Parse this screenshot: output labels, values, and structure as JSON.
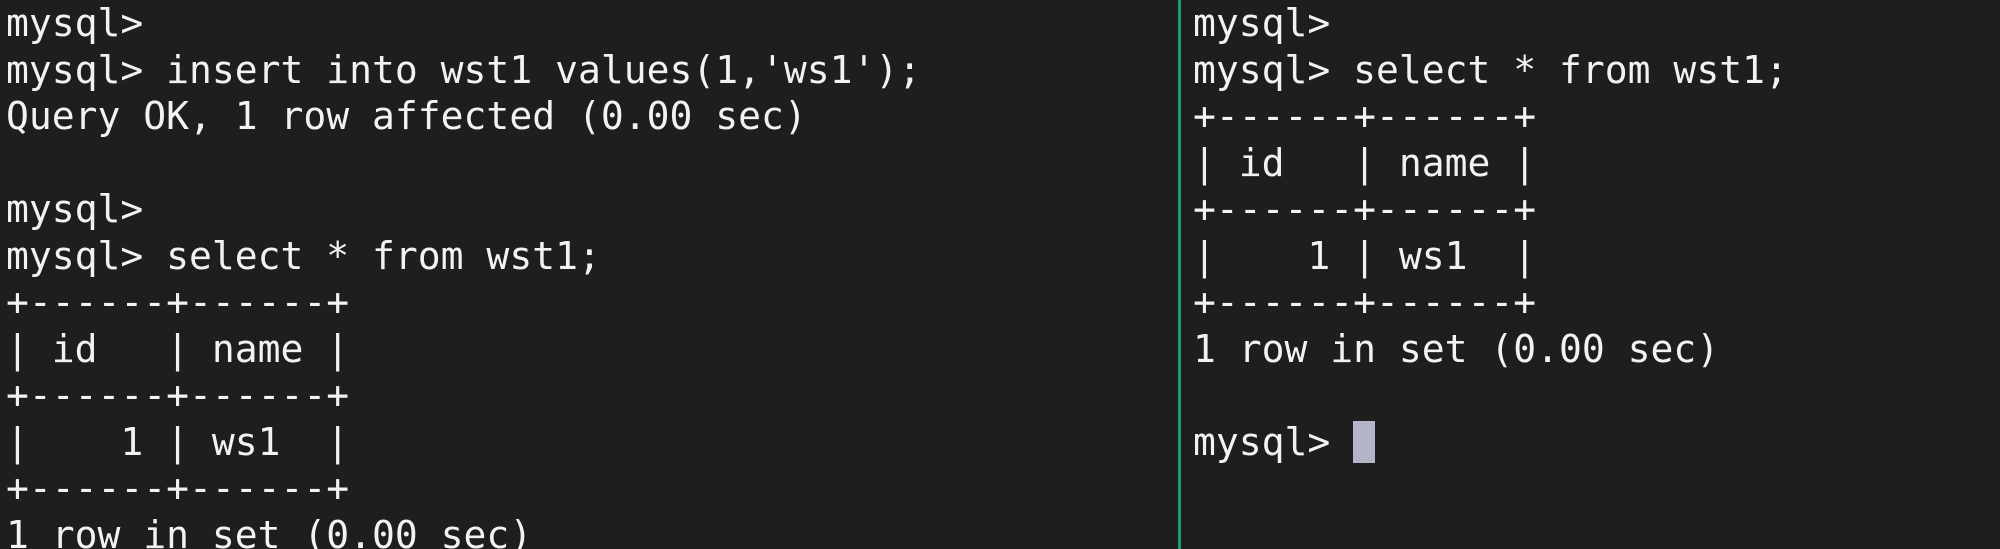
{
  "left_pane": {
    "lines": [
      "mysql>",
      "mysql> insert into wst1 values(1,'ws1');",
      "Query OK, 1 row affected (0.00 sec)",
      "",
      "mysql>",
      "mysql> select * from wst1;",
      "+------+------+",
      "| id   | name |",
      "+------+------+",
      "|    1 | ws1  |",
      "+------+------+",
      "1 row in set (0.00 sec)"
    ]
  },
  "right_pane": {
    "lines": [
      "mysql>",
      "mysql> select * from wst1;",
      "+------+------+",
      "| id   | name |",
      "+------+------+",
      "|    1 | ws1  |",
      "+------+------+",
      "1 row in set (0.00 sec)",
      "",
      "mysql> "
    ]
  },
  "colors": {
    "background": "#1e1e1e",
    "text": "#f2f2f2",
    "divider": "#1f9d6a",
    "cursor": "#b4b4c8"
  }
}
